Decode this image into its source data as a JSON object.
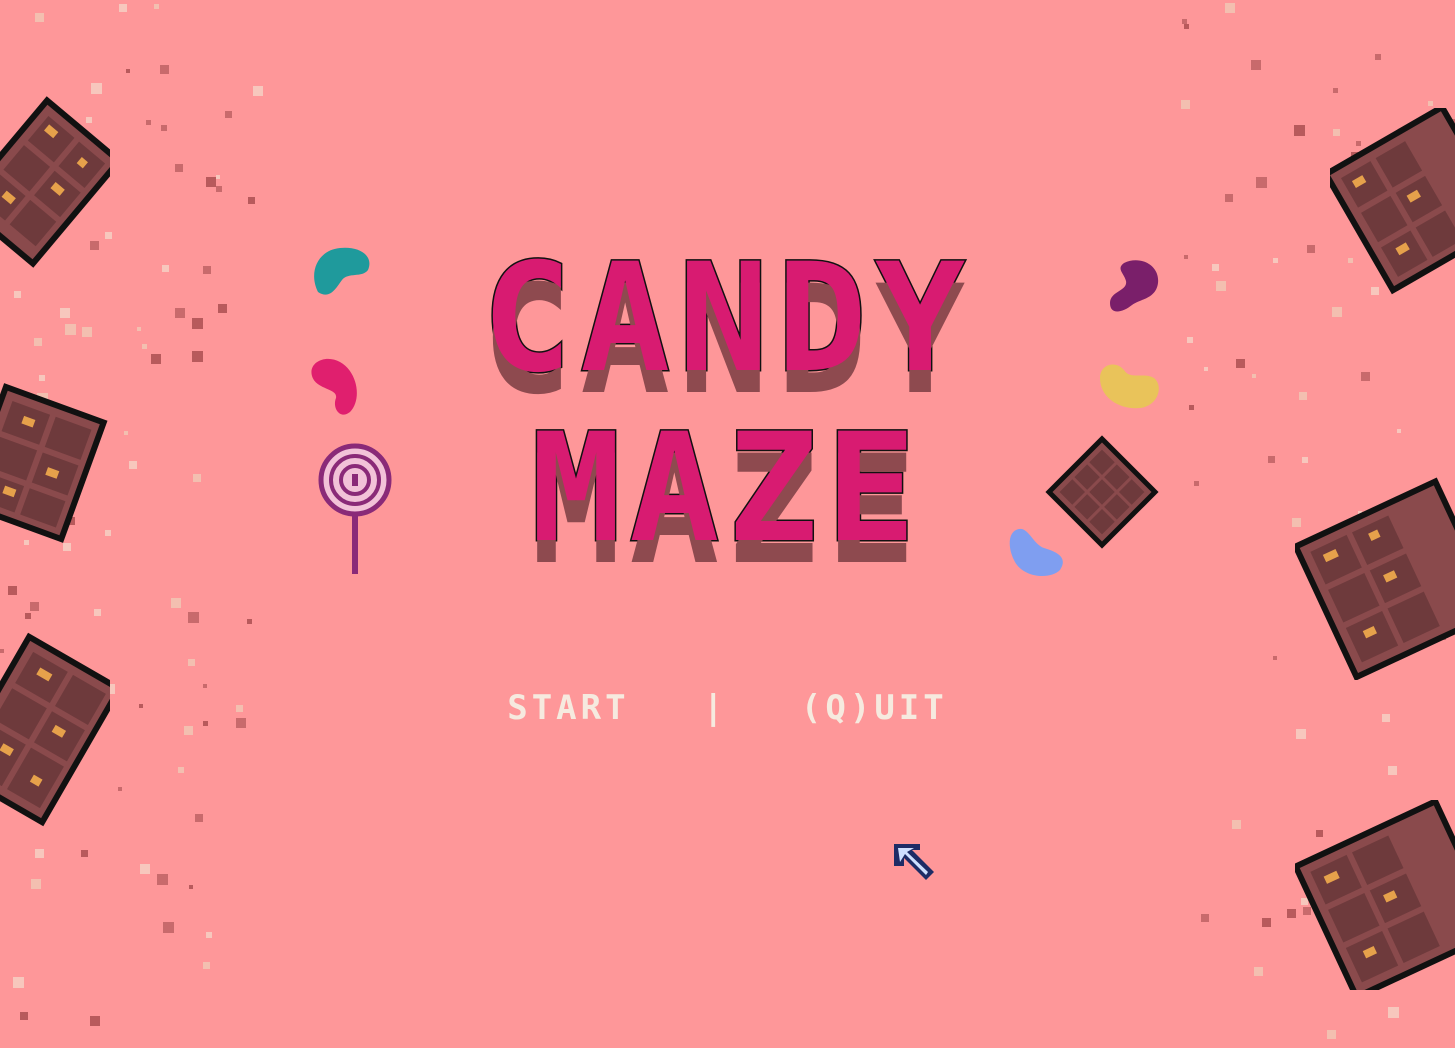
{
  "title": {
    "line1": "CANDY",
    "line2": "MAZE"
  },
  "menu": {
    "start_label": "START",
    "separator": "|",
    "quit_label": "(Q)UIT"
  },
  "colors": {
    "background": "#fe9799",
    "title_pink": "#d81b71",
    "title_chocolate": "#8e4a4f",
    "menu_text": "#f6eadf",
    "chocolate_bar": "#8a4a4c",
    "chocolate_outline": "#111111",
    "caramel": "#e6a14b",
    "jellybean_teal": "#1f9a9c",
    "jellybean_pink": "#e01f6e",
    "jellybean_purple": "#7a1f6a",
    "jellybean_yellow": "#e9c35a",
    "jellybean_blue": "#7f9ef0",
    "lollipop": "#8a2a78"
  },
  "icons": {
    "cursor": "pixel-arrow-cursor",
    "lollipop": "lollipop-icon",
    "chocolate_bar": "chocolate-bar-icon",
    "jellybean": "jellybean-icon"
  }
}
